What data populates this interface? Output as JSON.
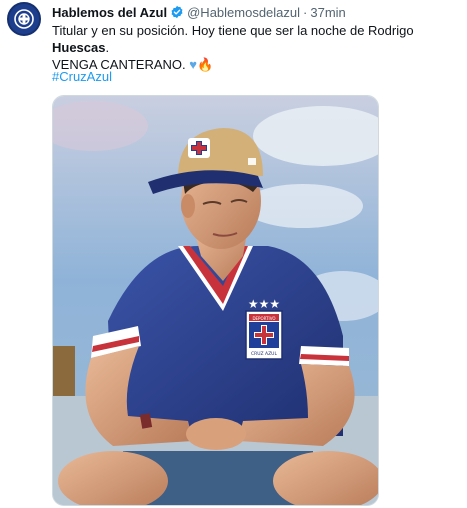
{
  "tweet": {
    "author_name": "Hablemos del Azul",
    "handle": "@Hablemosdelazul",
    "separator": "·",
    "time": "37min",
    "text_line1": "Titular y en su posición. Hoy tiene que ser la noche de Rodrigo",
    "text_bold": "Huescas",
    "text_line1_end": ".",
    "text_line2": "VENGA CANTERANO.",
    "hashtag": "#CruzAzul",
    "media_badge_text": "DEPORTIVO",
    "media_badge_text2": "CRUZ AZUL"
  },
  "colors": {
    "link": "#1d9bf0",
    "verified": "#1d9bf0",
    "secondary_text": "#536471",
    "jersey": "#2a3f8f"
  },
  "icons": {
    "verified": "verified-badge-icon",
    "heart": "blue-heart-emoji",
    "fire": "fire-emoji"
  }
}
